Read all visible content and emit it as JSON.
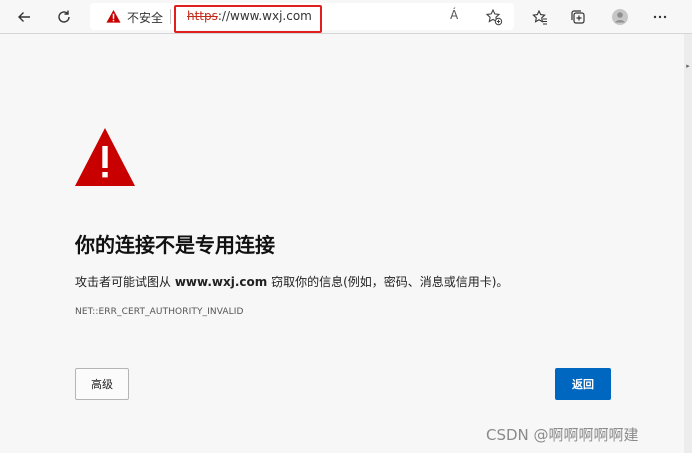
{
  "toolbar": {
    "security_label": "不安全",
    "url_scheme": "https",
    "url_rest": "://www.wxj.com",
    "read_aloud": "Á"
  },
  "error": {
    "heading": "你的连接不是专用连接",
    "desc_before": "攻击者可能试图从 ",
    "desc_domain": "www.wxj.com",
    "desc_after": " 窃取你的信息(例如，密码、消息或信用卡)。",
    "code": "NET::ERR_CERT_AUTHORITY_INVALID"
  },
  "buttons": {
    "advanced": "高级",
    "back": "返回"
  },
  "watermark": "CSDN @啊啊啊啊啊建",
  "colors": {
    "warning_red": "#c80000",
    "primary_blue": "#0067c0",
    "annotation_red": "#e0201c"
  },
  "icons": [
    "back-arrow-icon",
    "refresh-icon",
    "warning-icon",
    "read-aloud-icon",
    "add-favorite-icon",
    "favorites-icon",
    "collections-icon",
    "profile-icon",
    "more-icon"
  ]
}
